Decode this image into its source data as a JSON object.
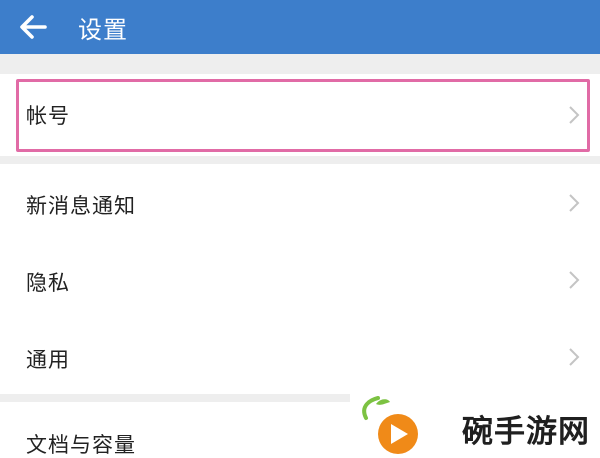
{
  "header": {
    "title": "设置",
    "back_icon": "arrow-left-icon",
    "background": "#3d7ecb"
  },
  "settings": {
    "account": "帐号",
    "notifications": "新消息通知",
    "privacy": "隐私",
    "general": "通用",
    "storage": "文档与容量"
  },
  "highlight_color": "#e16ba6",
  "watermark": {
    "text": "碗手游网",
    "logo_icon": "orange-play-logo"
  }
}
